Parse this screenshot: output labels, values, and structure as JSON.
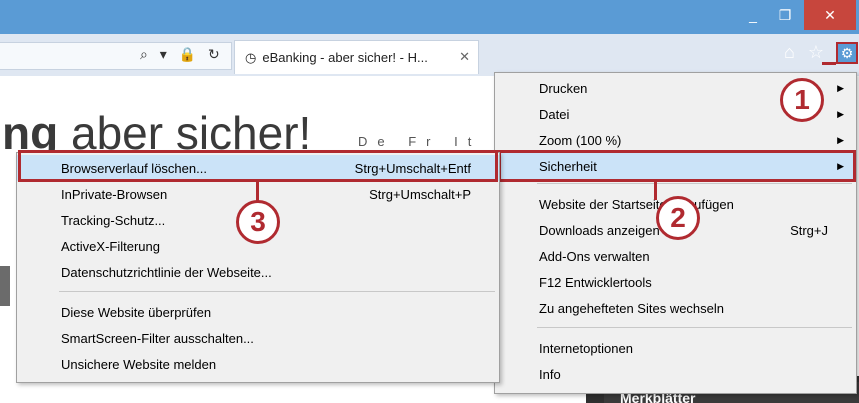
{
  "window": {
    "minimize": "_",
    "maximize": "❐",
    "close": "✕"
  },
  "address": {
    "icons": "⌕ ▾ 🔒 ↻"
  },
  "tab": {
    "title": "eBanking - aber sicher! - H...",
    "close": "✕"
  },
  "toolbar": {
    "home": "⌂",
    "star": "☆",
    "gear": "⚙"
  },
  "page": {
    "brand_bold": "ng",
    "brand_rest": " aber sicher!",
    "langs": "De Fr It En",
    "merk": "Merkblätter"
  },
  "main_menu": {
    "items": [
      {
        "label": "Drucken",
        "has_sub": true
      },
      {
        "label": "Datei",
        "has_sub": true
      },
      {
        "label": "Zoom (100 %)",
        "has_sub": true
      },
      {
        "label": "Sicherheit",
        "has_sub": true
      },
      {
        "label": "Website der Startseite hinzufügen",
        "has_sub": false
      },
      {
        "label": "Downloads anzeigen",
        "shortcut": "Strg+J"
      },
      {
        "label": "Add-Ons verwalten"
      },
      {
        "label": "F12 Entwicklertools"
      },
      {
        "label": "Zu angehefteten Sites wechseln"
      },
      {
        "label": "Internetoptionen"
      },
      {
        "label": "Info"
      }
    ]
  },
  "sub_menu": {
    "items": [
      {
        "label": "Browserverlauf löschen...",
        "shortcut": "Strg+Umschalt+Entf"
      },
      {
        "label": "InPrivate-Browsen",
        "shortcut": "Strg+Umschalt+P"
      },
      {
        "label": "Tracking-Schutz..."
      },
      {
        "label": "ActiveX-Filterung"
      },
      {
        "label": "Datenschutzrichtlinie der Webseite..."
      },
      {
        "label": "Diese Website überprüfen"
      },
      {
        "label": "SmartScreen-Filter ausschalten..."
      },
      {
        "label": "Unsichere Website melden"
      }
    ]
  },
  "badges": {
    "one": "1",
    "two": "2",
    "three": "3"
  },
  "colors": {
    "title_bar": "#5a9bd5",
    "highlight": "#cbe3f8",
    "annotation": "#b02a30"
  }
}
